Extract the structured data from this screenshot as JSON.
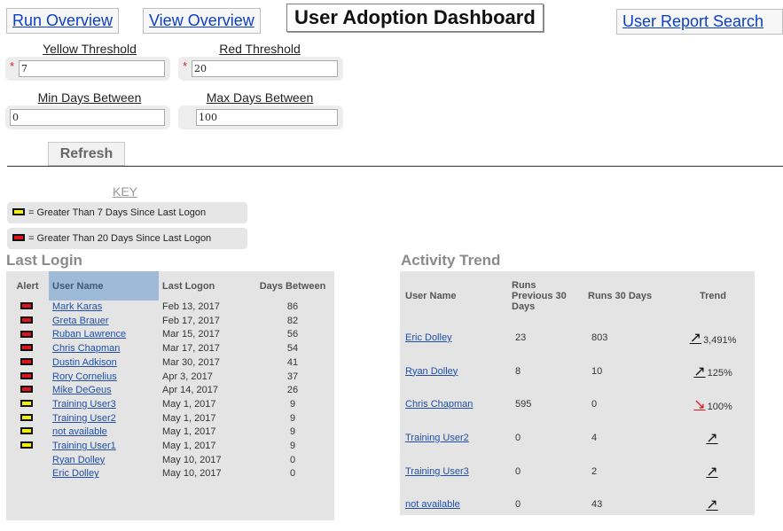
{
  "tabs": [
    {
      "label": "Run Overview"
    },
    {
      "label": "View Overview"
    },
    {
      "label": "User Adoption Dashboard"
    },
    {
      "label": "User Report Search"
    }
  ],
  "filters": {
    "yellow": {
      "label": "Yellow Threshold",
      "value": "7",
      "required": true
    },
    "red": {
      "label": "Red Threshold",
      "value": "20",
      "required": true
    },
    "min_days": {
      "label": "Min Days Between",
      "value": "0"
    },
    "max_days": {
      "label": "Max Days Between",
      "value": "100"
    },
    "refresh_label": "Refresh",
    "required_mark": "*"
  },
  "key": {
    "title": "KEY",
    "items": [
      {
        "color": "yellow",
        "text": "= Greater Than 7 Days Since Last Logon"
      },
      {
        "color": "red",
        "text": "= Greater Than 20 Days Since Last Logon"
      }
    ]
  },
  "colors": {
    "yellow": "#f5f000",
    "red": "#e0121c",
    "link": "#1f4fa8",
    "selected_header": "#9fbad6"
  },
  "last_login": {
    "title": "Last Login",
    "headers": [
      "Alert",
      "User Name",
      "Last Logon",
      "Days Between"
    ],
    "rows": [
      {
        "alert": "red",
        "user": "Mark Karas",
        "logon": "Feb 13, 2017",
        "days": "86"
      },
      {
        "alert": "red",
        "user": "Greta Brauer",
        "logon": "Feb 17, 2017",
        "days": "82"
      },
      {
        "alert": "red",
        "user": "Ruban Lawrence",
        "logon": "Mar 15, 2017",
        "days": "56"
      },
      {
        "alert": "red",
        "user": "Chris Chapman",
        "logon": "Mar 17, 2017",
        "days": "54"
      },
      {
        "alert": "red",
        "user": "Dustin Adkison",
        "logon": "Mar 30, 2017",
        "days": "41"
      },
      {
        "alert": "red",
        "user": "Rory Cornelius",
        "logon": "Apr 3, 2017",
        "days": "37"
      },
      {
        "alert": "red",
        "user": "Mike DeGeus",
        "logon": "Apr 14, 2017",
        "days": "26"
      },
      {
        "alert": "yellow",
        "user": "Training User3",
        "logon": "May 1, 2017",
        "days": "9"
      },
      {
        "alert": "yellow",
        "user": "Training User2",
        "logon": "May 1, 2017",
        "days": "9"
      },
      {
        "alert": "yellow",
        "user": "not available",
        "logon": "May 1, 2017",
        "days": "9"
      },
      {
        "alert": "yellow",
        "user": "Training User1",
        "logon": "May 1, 2017",
        "days": "9"
      },
      {
        "alert": "",
        "user": "Ryan Dolley",
        "logon": "May 10, 2017",
        "days": "0"
      },
      {
        "alert": "",
        "user": "Eric Dolley",
        "logon": "May 10, 2017",
        "days": "0"
      }
    ]
  },
  "activity_trend": {
    "title": "Activity Trend",
    "headers": [
      "User Name",
      "Runs Previous 30 Days",
      "Runs 30 Days",
      "Trend"
    ],
    "rows": [
      {
        "user": "Eric Dolley",
        "prev": "23",
        "current": "803",
        "trend": "up",
        "pct": "3,491%"
      },
      {
        "user": "Ryan Dolley",
        "prev": "8",
        "current": "10",
        "trend": "up",
        "pct": "125%"
      },
      {
        "user": "Chris Chapman",
        "prev": "595",
        "current": "0",
        "trend": "down",
        "pct": "100%"
      },
      {
        "user": "Training User2",
        "prev": "0",
        "current": "4",
        "trend": "up",
        "pct": ""
      },
      {
        "user": "Training User3",
        "prev": "0",
        "current": "2",
        "trend": "up",
        "pct": ""
      },
      {
        "user": "not available",
        "prev": "0",
        "current": "43",
        "trend": "up",
        "pct": ""
      }
    ]
  }
}
